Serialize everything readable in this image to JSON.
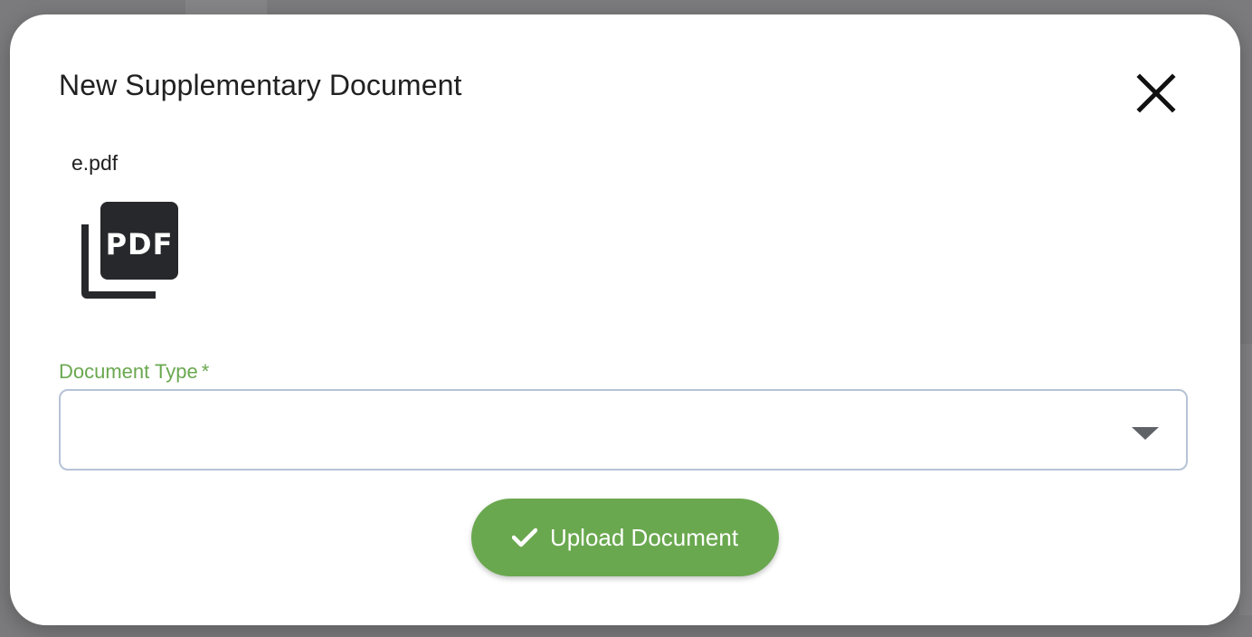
{
  "dialog": {
    "title": "New Supplementary Document",
    "close_icon": "close-icon"
  },
  "file": {
    "name": "e.pdf",
    "icon": "pdf-file-icon",
    "icon_text": "PDF"
  },
  "document_type": {
    "label": "Document Type",
    "required_marker": "*",
    "value": "",
    "chevron_icon": "chevron-down-icon"
  },
  "upload_button": {
    "label": "Upload Document",
    "icon": "check-icon",
    "color": "#6aa84f"
  }
}
